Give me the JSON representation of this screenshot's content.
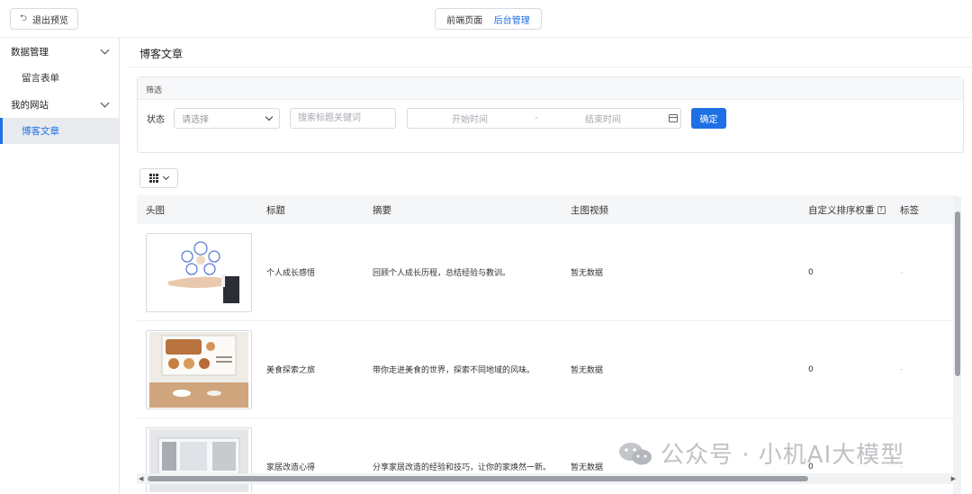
{
  "topbar": {
    "exit_label": "退出预览",
    "switch_front": "前端页面",
    "switch_back": "后台管理"
  },
  "sidebar": {
    "groups": [
      {
        "label": "数据管理",
        "items": [
          {
            "label": "留言表单"
          }
        ]
      },
      {
        "label": "我的网站",
        "items": [
          {
            "label": "博客文章"
          }
        ]
      }
    ]
  },
  "page": {
    "title": "博客文章"
  },
  "filter": {
    "header": "筛选",
    "status_label": "状态",
    "status_placeholder": "请选择",
    "keyword_placeholder": "搜索标题关键词",
    "start_placeholder": "开始时间",
    "range_separator": "-",
    "end_placeholder": "结束时间",
    "confirm_label": "确定"
  },
  "table": {
    "columns": [
      "头图",
      "标题",
      "摘要",
      "主图视频",
      "自定义排序权重",
      "标签"
    ],
    "help_glyph": "?",
    "rows": [
      {
        "title": "个人成长感悟",
        "summary": "回顾个人成长历程，总结经验与教训。",
        "video": "暂无数据",
        "weight": "0",
        "tags": "-",
        "image": "hand-diagram"
      },
      {
        "title": "美食探索之旅",
        "summary": "带你走进美食的世界，探索不同地域的风味。",
        "video": "暂无数据",
        "weight": "0",
        "tags": "-",
        "image": "food-board"
      },
      {
        "title": "家居改造心得",
        "summary": "分享家居改造的经验和技巧，让你的家焕然一新。",
        "video": "暂无数据",
        "weight": "0",
        "tags": "-",
        "image": "living-room"
      }
    ]
  },
  "watermark": {
    "text": "公众号 · 小机AI大模型"
  },
  "colors": {
    "accent": "#1f6fe5",
    "sidebar_active_bg": "#e8eaee"
  }
}
